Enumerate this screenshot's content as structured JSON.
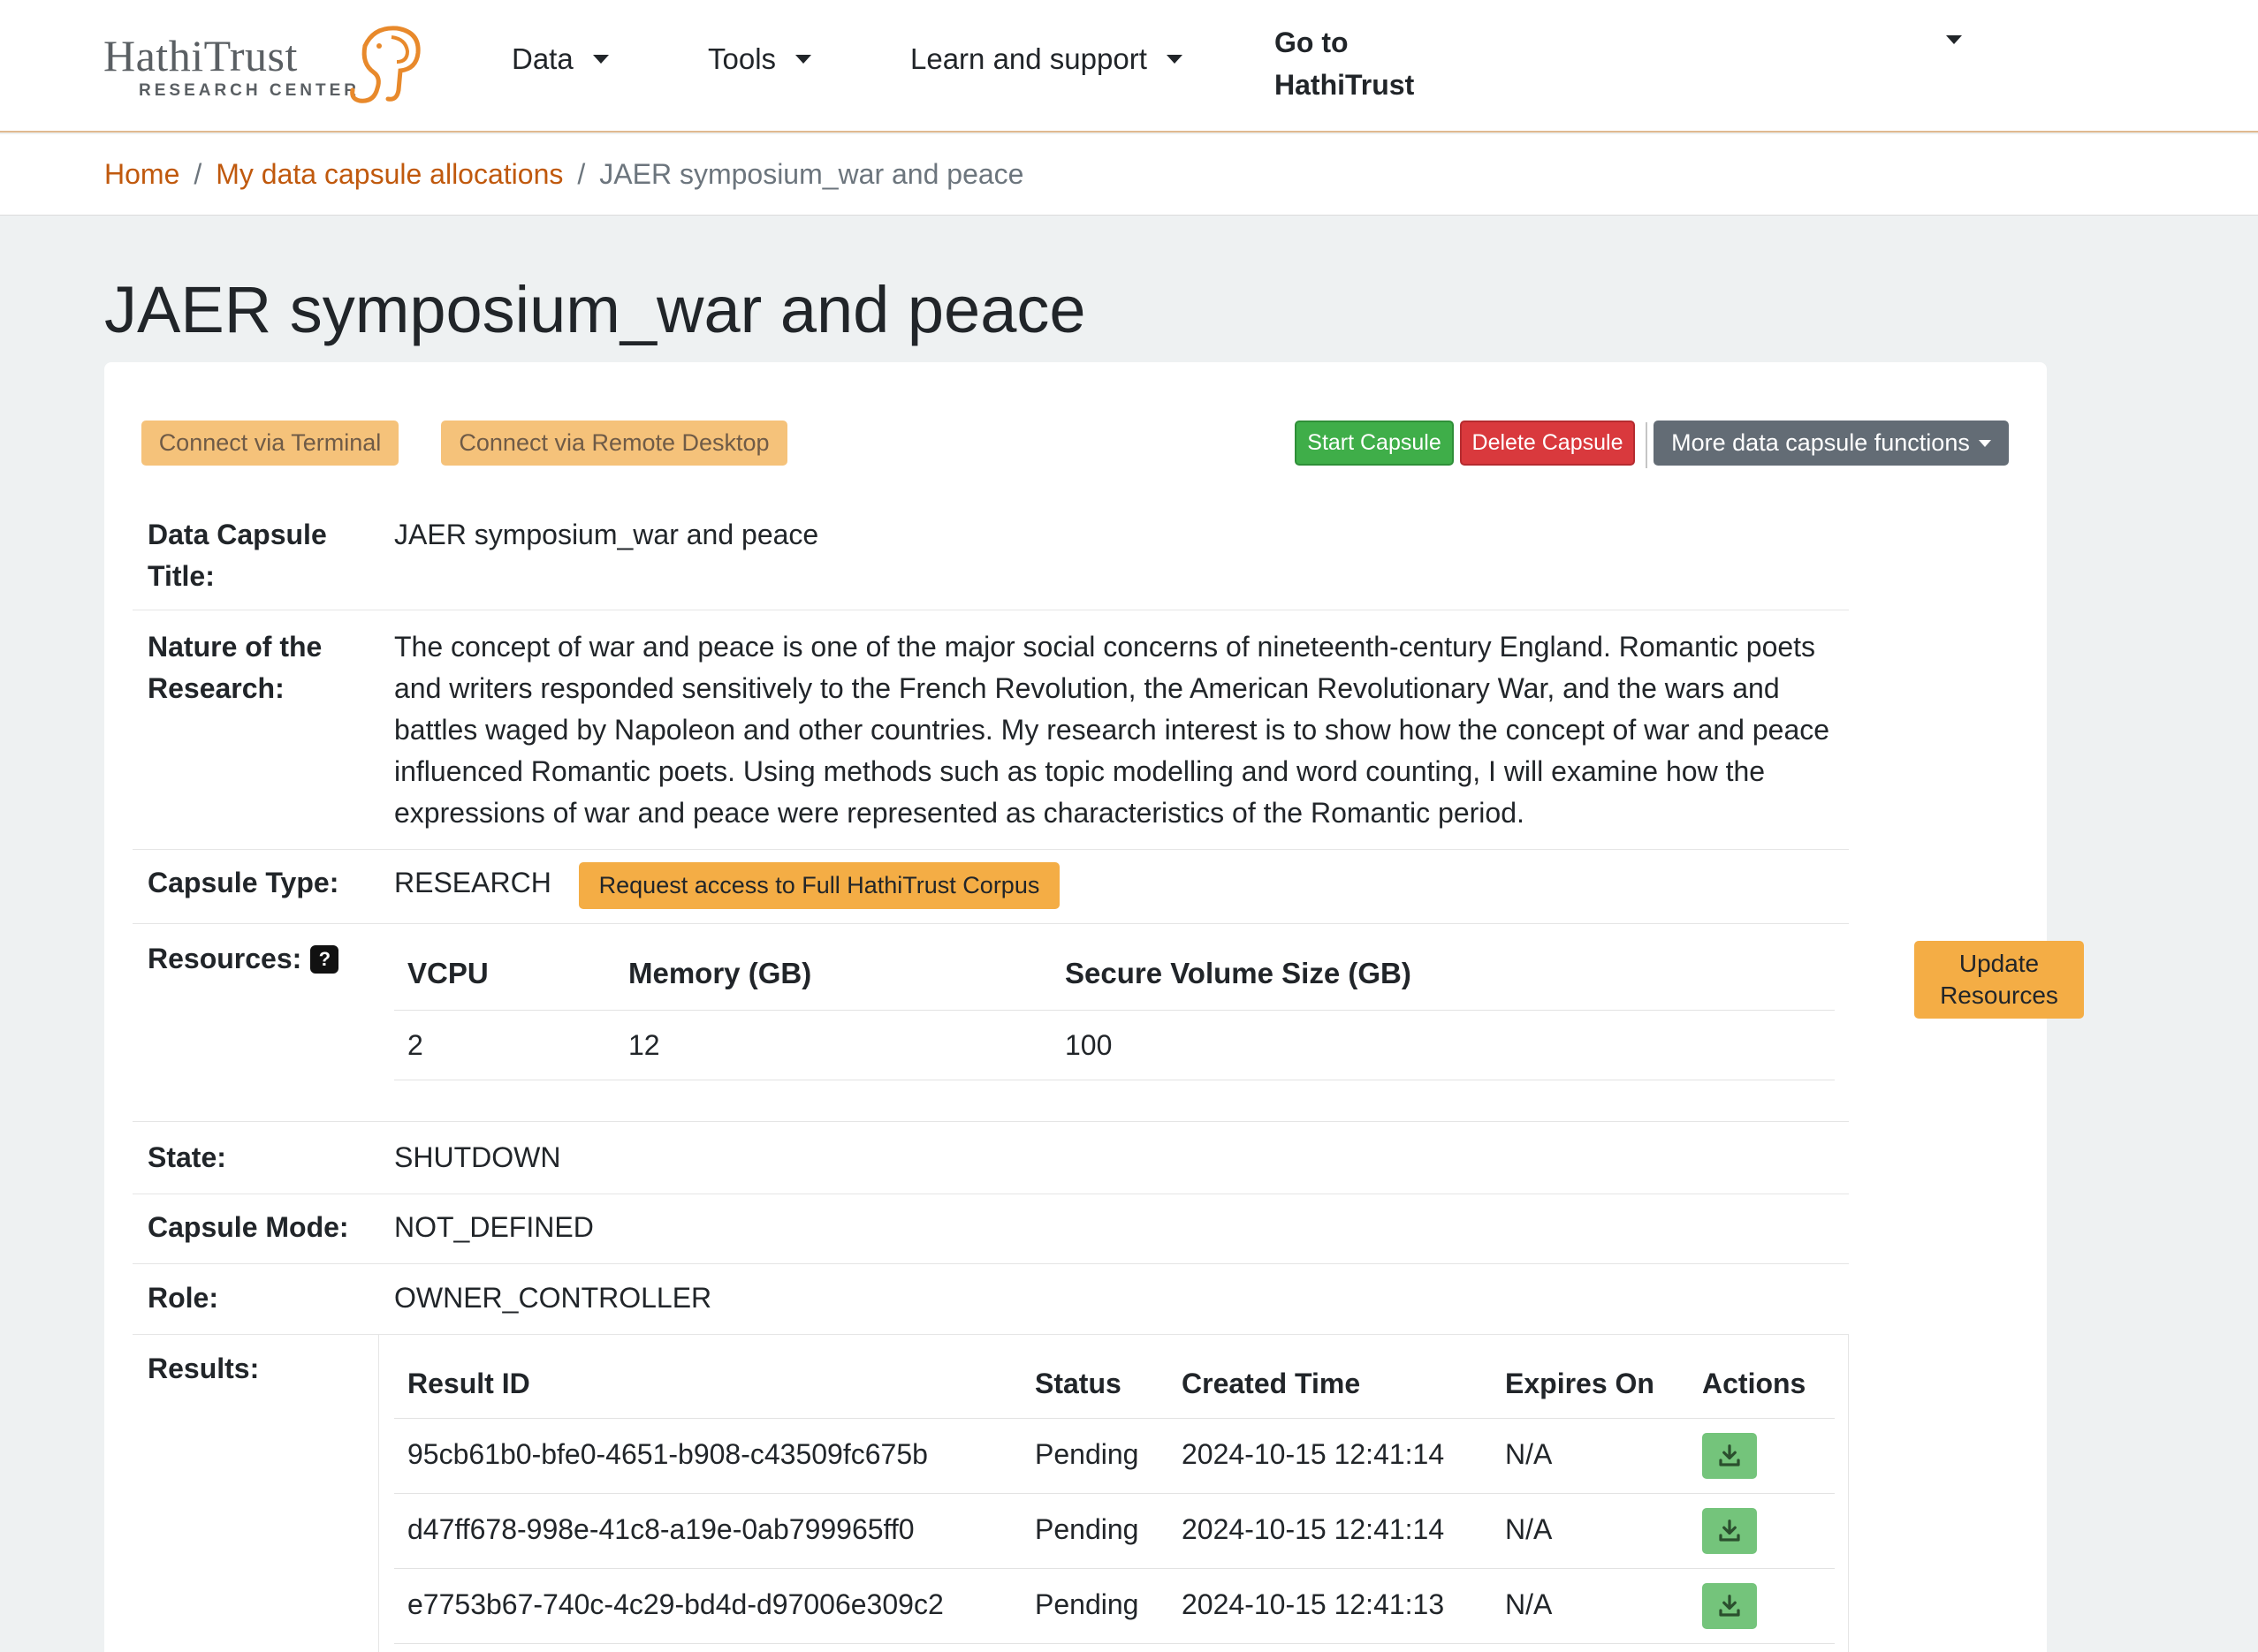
{
  "header": {
    "logo_text": "HathiTrust",
    "logo_sub": "RESEARCH CENTER",
    "nav": [
      "Data",
      "Tools",
      "Learn and support"
    ],
    "goto_line1": "Go to",
    "goto_line2": "HathiTrust"
  },
  "breadcrumb": {
    "home": "Home",
    "allocations": "My data capsule allocations",
    "current": "JAER symposium_war and peace"
  },
  "page_title": "JAER symposium_war and peace",
  "actions": {
    "connect_terminal": "Connect via Terminal",
    "connect_remote": "Connect via Remote Desktop",
    "start": "Start Capsule",
    "delete": "Delete Capsule",
    "more": "More data capsule functions"
  },
  "details": {
    "title_label": "Data Capsule Title:",
    "title_value": "JAER symposium_war and peace",
    "nature_label": "Nature of the Research:",
    "nature_lines": [
      "The concept of war and peace is one of the major social concerns of nineteenth-century England. Romantic poets",
      "and writers responded sensitively to the French Revolution, the American Revolutionary War, and the wars and",
      "battles waged by Napoleon and other countries. My research interest is to show how the concept of war and peace",
      "influenced Romantic poets. Using methods such as topic modelling and word counting, I will examine how the",
      "expressions of war and peace were represented as characteristics of the Romantic period."
    ],
    "type_label": "Capsule Type:",
    "type_value": "RESEARCH",
    "request_access": "Request access to Full HathiTrust Corpus",
    "resources_label": "Resources:",
    "help_glyph": "?",
    "resources_headers": [
      "VCPU",
      "Memory (GB)",
      "Secure Volume Size (GB)"
    ],
    "resources_values": [
      "2",
      "12",
      "100"
    ],
    "update_line1": "Update",
    "update_line2": "Resources",
    "state_label": "State:",
    "state_value": "SHUTDOWN",
    "mode_label": "Capsule Mode:",
    "mode_value": "NOT_DEFINED",
    "role_label": "Role:",
    "role_value": "OWNER_CONTROLLER",
    "results_label": "Results:"
  },
  "results": {
    "headers": [
      "Result ID",
      "Status",
      "Created Time",
      "Expires On",
      "Actions"
    ],
    "rows": [
      {
        "id": "95cb61b0-bfe0-4651-b908-c43509fc675b",
        "status": "Pending",
        "created": "2024-10-15 12:41:14",
        "expires": "N/A"
      },
      {
        "id": "d47ff678-998e-41c8-a19e-0ab799965ff0",
        "status": "Pending",
        "created": "2024-10-15 12:41:14",
        "expires": "N/A"
      },
      {
        "id": "e7753b67-740c-4c29-bd4d-d97006e309c2",
        "status": "Pending",
        "created": "2024-10-15 12:41:13",
        "expires": "N/A"
      }
    ]
  },
  "colors": {
    "link": "#c0590d",
    "accent_orange": "#f4ad45",
    "start_green": "#3fae49",
    "delete_red": "#d9393d",
    "download_green": "#74c47b"
  },
  "icons": {
    "logo": "elephant-icon",
    "download": "download-icon",
    "help": "question-icon"
  }
}
